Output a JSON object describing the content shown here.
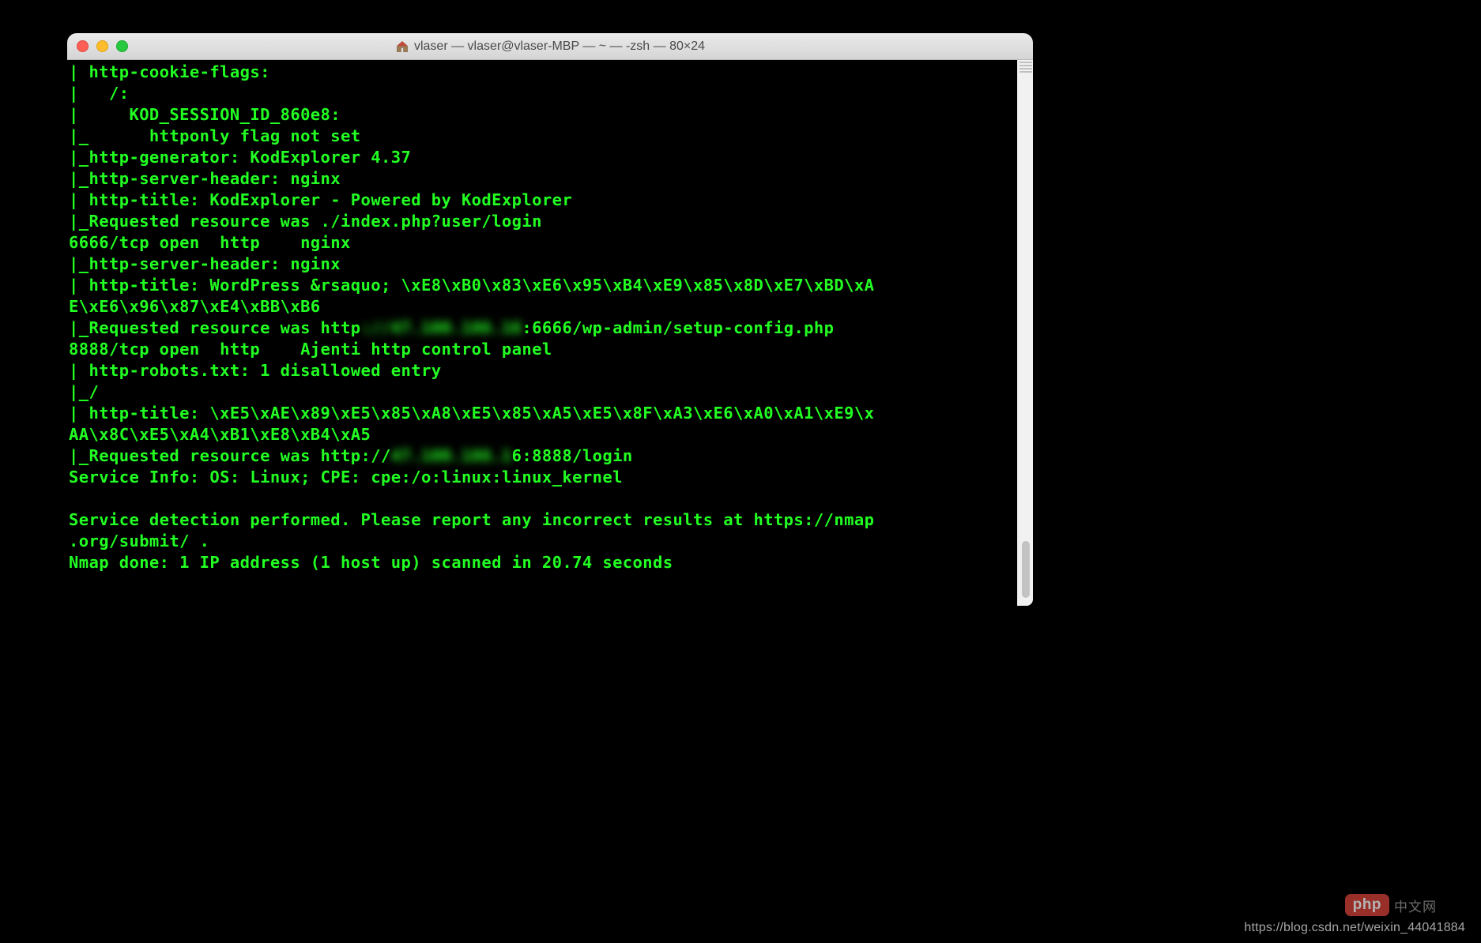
{
  "window": {
    "title": "vlaser — vlaser@vlaser-MBP — ~ — -zsh — 80×24"
  },
  "terminal": {
    "lines": [
      "| http-cookie-flags:",
      "|   /:",
      "|     KOD_SESSION_ID_860e8:",
      "|_      httponly flag not set",
      "|_http-generator: KodExplorer 4.37",
      "|_http-server-header: nginx",
      "| http-title: KodExplorer - Powered by KodExplorer",
      "|_Requested resource was ./index.php?user/login",
      "6666/tcp open  http    nginx",
      "|_http-server-header: nginx",
      "| http-title: WordPress &rsaquo; \\xE8\\xB0\\x83\\xE6\\x95\\xB4\\xE9\\x85\\x8D\\xE7\\xBD\\xA",
      "E\\xE6\\x96\\x87\\xE4\\xBB\\xB6",
      {
        "prefix": "|_Requested resource was http",
        "blur": "://47.100.186.16",
        "suffix": ":6666/wp-admin/setup-config.php"
      },
      "8888/tcp open  http    Ajenti http control panel",
      "| http-robots.txt: 1 disallowed entry",
      "|_/",
      "| http-title: \\xE5\\xAE\\x89\\xE5\\x85\\xA8\\xE5\\x85\\xA5\\xE5\\x8F\\xA3\\xE6\\xA0\\xA1\\xE9\\x",
      "AA\\x8C\\xE5\\xA4\\xB1\\xE8\\xB4\\xA5",
      {
        "prefix": "|_Requested resource was http://",
        "blur": "47.100.186.1",
        "suffix": "6:8888/login"
      },
      "Service Info: OS: Linux; CPE: cpe:/o:linux:linux_kernel",
      "",
      "Service detection performed. Please report any incorrect results at https://nmap",
      ".org/submit/ .",
      "Nmap done: 1 IP address (1 host up) scanned in 20.74 seconds"
    ]
  },
  "watermark": {
    "php_pill": "php",
    "php_cn": "中文网",
    "csdn": "https://blog.csdn.net/weixin_44041884"
  },
  "colors": {
    "term_fg": "#22ff22",
    "term_bg": "#000000",
    "traffic_red": "#ff5f57",
    "traffic_yellow": "#ffbd2e",
    "traffic_green": "#28c940"
  }
}
